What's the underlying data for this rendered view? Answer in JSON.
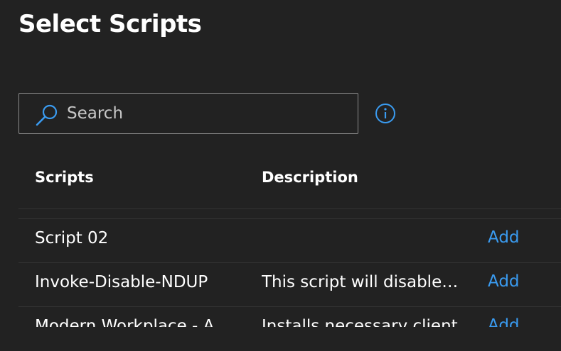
{
  "page": {
    "title": "Select Scripts"
  },
  "search": {
    "placeholder": "Search",
    "value": ""
  },
  "table": {
    "columns": [
      "Scripts",
      "Description"
    ],
    "rows": [
      {
        "name": "Script 02",
        "description": "",
        "action": "Add"
      },
      {
        "name": "Invoke-Disable-NDUP",
        "description": "This script will disable NDUP",
        "action": "Add"
      },
      {
        "name": "Modern Workplace - A",
        "description": "Installs necessary client",
        "action": "Add"
      }
    ]
  },
  "colors": {
    "background": "#222222",
    "accent": "#3a9bf0",
    "text": "#ffffff",
    "border": "#8a8a8a"
  },
  "icons": {
    "search": "search-icon",
    "info": "info-icon"
  }
}
